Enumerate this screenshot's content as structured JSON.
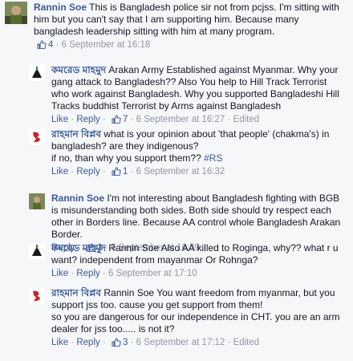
{
  "comments": [
    {
      "author": "Rannin Soe",
      "paragraphs": [
        "This is Bangladesh police sir not from pcjss. I'm sitting with him but you can't say that I am supporting him. Because many bangladesh leadership sitting with him at many program."
      ],
      "actions": {
        "likes": "4",
        "timestamp": "6 September at 16:18"
      }
    },
    {
      "author": "কমরেড মাহমুদ",
      "paragraphs": [
        "Arakan Army Established against Myanmar. Why your gang attack to Bangladesh?? Also You help to Hill Track Terrorist who work against Bangladesh. Why you supported Bangladeshi Hill Tracks buddhist Terrorist by Arms against Bangladesh"
      ],
      "actions": {
        "like": "Like",
        "reply": "Reply",
        "likes": "7",
        "timestamp": "6 September at 16:27",
        "edited": "Edited"
      }
    },
    {
      "author": "রাহমান বিপ্লব",
      "paragraphs": [
        "what is your opinion about 'that people' (chakma's) in bangladesh? are they indigenous?",
        "if no, than why you support them?? #RS"
      ],
      "actions": {
        "like": "Like",
        "reply": "Reply",
        "likes": "1",
        "timestamp": "6 September at 16:32"
      }
    },
    {
      "author": "Rannin Soe",
      "paragraphs": [
        "I'm not interesting about Bangladesh fighting with BGB is misunderstanding both sides. Both side should try respect each other in Borders line. Because AA control whole Bangladesh Arakan Border."
      ],
      "actions": {
        "reply": "Reply",
        "likes": "1",
        "timestamp": "6 September at 16:39"
      }
    },
    {
      "author": "কমরেড মাহমুদ",
      "paragraphs": [
        "Rannin Soe Also AA killed to Roginga, why?? what r u want? independent from mayanmar Or Rohnga?"
      ],
      "actions": {
        "like": "Like",
        "reply": "Reply",
        "timestamp": "6 September at 17:10"
      }
    },
    {
      "author": "রাহমান বিপ্লব",
      "paragraphs": [
        "Rannin Soe You want freedom from myanmar, but you support jss too. cause you get support from them!",
        "so you are dangerous for our independence in CHT. you are an arm dealer for jss too..... is not it?"
      ],
      "actions": {
        "like": "Like",
        "reply": "Reply",
        "likes": "3",
        "timestamp": "6 September at 17:12",
        "edited": "Edited"
      }
    }
  ],
  "colors": {
    "link": "#3b5998",
    "meta": "#9197a3",
    "background": "#f6f7f9",
    "text": "#141823"
  },
  "icons": [
    "thumbs-up-icon",
    "avatar-rannin-soe",
    "avatar-komred-mahmud",
    "avatar-rahman-biplob"
  ]
}
